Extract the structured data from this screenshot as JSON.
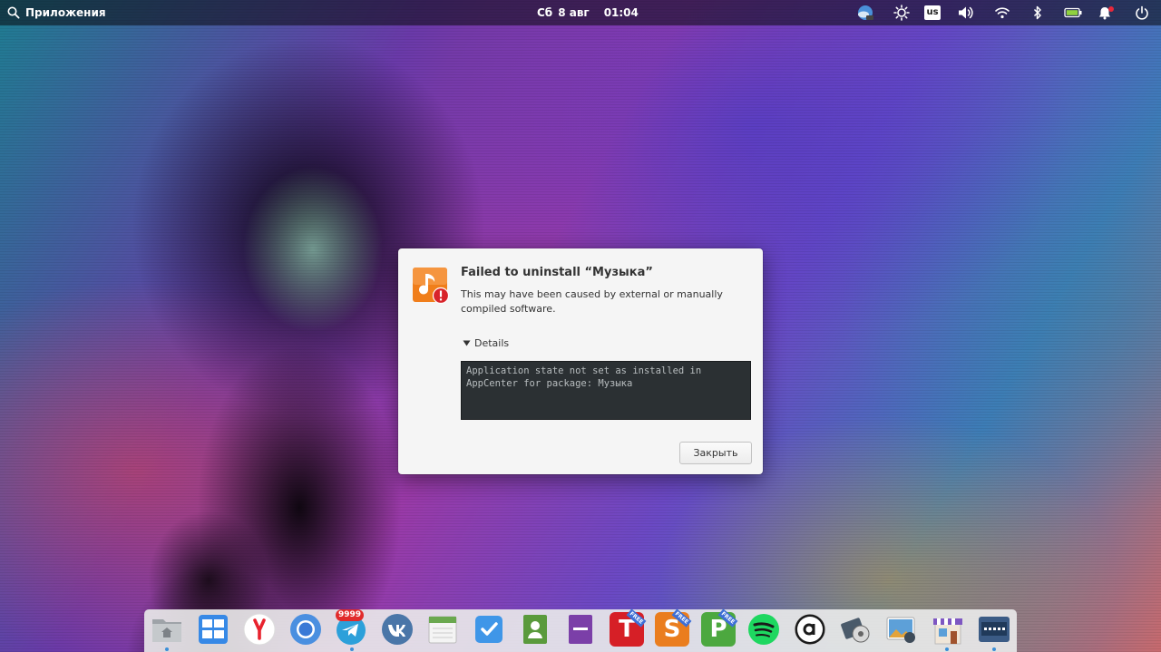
{
  "top_panel": {
    "applications_label": "Приложения",
    "clock_day": "Сб",
    "clock_date": "8 авг",
    "clock_time": "01:04",
    "keyboard_layout": "us",
    "indicators": [
      "weather-icon",
      "brightness-icon",
      "keyboard-layout-indicator",
      "volume-icon",
      "wifi-icon",
      "bluetooth-icon",
      "battery-icon",
      "notifications-icon",
      "power-icon"
    ]
  },
  "dialog": {
    "title": "Failed to uninstall “Музыка”",
    "description": "This may have been caused by external or manually compiled software.",
    "details_label": "Details",
    "details_text": "Application state not set as installed in AppCenter for package: Музыка",
    "close_button": "Закрыть",
    "icon": "music-app-error-icon"
  },
  "dock": {
    "items": [
      {
        "name": "files",
        "icon": "files-icon"
      },
      {
        "name": "multitasking-view",
        "icon": "multitasking-icon"
      },
      {
        "name": "yandex-browser",
        "icon": "yandex-icon"
      },
      {
        "name": "chromium",
        "icon": "chromium-icon"
      },
      {
        "name": "telegram",
        "icon": "telegram-icon",
        "badge": "9999"
      },
      {
        "name": "vk",
        "icon": "vk-icon"
      },
      {
        "name": "calendar",
        "icon": "calendar-icon"
      },
      {
        "name": "tasks",
        "icon": "tasks-icon"
      },
      {
        "name": "contacts",
        "icon": "contacts-icon"
      },
      {
        "name": "notes",
        "icon": "notes-icon"
      },
      {
        "name": "wps-writer",
        "icon": "wps-writer-icon",
        "letter": "T",
        "ribbon": "FREE"
      },
      {
        "name": "wps-spreadsheets",
        "icon": "wps-spreadsheets-icon",
        "letter": "S",
        "ribbon": "FREE"
      },
      {
        "name": "wps-presentation",
        "icon": "wps-presentation-icon",
        "letter": "P",
        "ribbon": "FREE"
      },
      {
        "name": "spotify",
        "icon": "spotify-icon"
      },
      {
        "name": "amazon",
        "icon": "amazon-icon",
        "letter": "a"
      },
      {
        "name": "video-editor",
        "icon": "video-editor-icon"
      },
      {
        "name": "photos",
        "icon": "photos-icon"
      },
      {
        "name": "appcenter",
        "icon": "appcenter-icon"
      },
      {
        "name": "terminal",
        "icon": "terminal-icon"
      }
    ]
  }
}
